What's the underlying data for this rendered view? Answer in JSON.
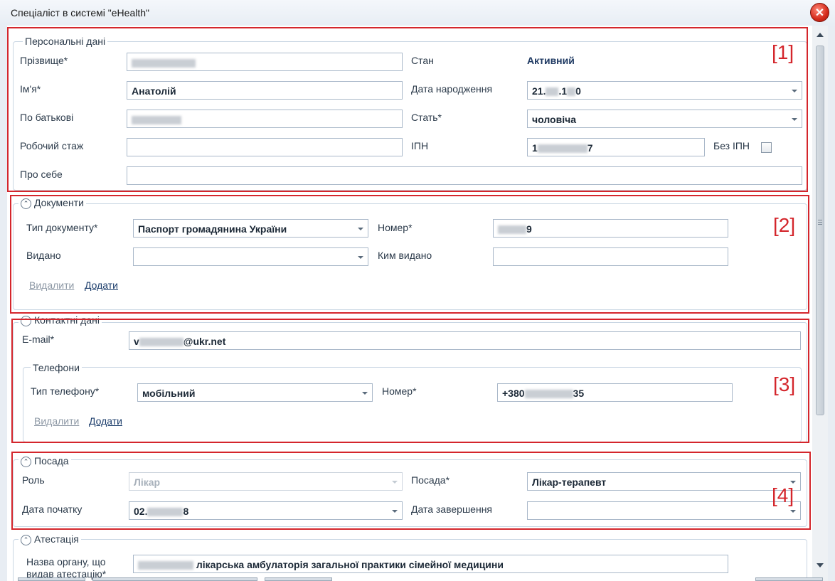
{
  "window": {
    "title": "Спеціаліст в системі \"eHealth\""
  },
  "personal": {
    "legend": "Персональні дані",
    "surname_label": "Прізвище*",
    "name_label": "Ім'я*",
    "name_value": "Анатолій",
    "patronymic_label": "По батькові",
    "experience_label": "Робочий стаж",
    "about_label": "Про себе",
    "status_label": "Стан",
    "status_value": "Активний",
    "birthdate_label": "Дата народження",
    "birthdate_parts": [
      "21.",
      ".1",
      "0"
    ],
    "sex_label": "Стать*",
    "sex_value": "чоловіча",
    "ipn_label": "ІПН",
    "ipn_parts": [
      "1",
      "7"
    ],
    "no_ipn_label": "Без ІПН",
    "tag": "[1]"
  },
  "documents": {
    "legend": "Документи",
    "doc_type_label": "Тип документу*",
    "doc_type_value": "Паспорт громадянина України",
    "number_label": "Номер*",
    "number_suffix": "9",
    "issued_label": "Видано",
    "issued_by_label": "Ким видано",
    "delete_link": "Видалити",
    "add_link": "Додати",
    "tag": "[2]"
  },
  "contacts": {
    "legend": "Контактні дані",
    "email_label": "E-mail*",
    "email_prefix": "v",
    "email_suffix": "@ukr.net",
    "phones_legend": "Телефони",
    "phone_type_label": "Тип телефону*",
    "phone_type_value": "мобільний",
    "phone_number_label": "Номер*",
    "phone_prefix": "+380",
    "phone_suffix": "35",
    "delete_link": "Видалити",
    "add_link": "Додати",
    "tag": "[3]"
  },
  "position": {
    "legend": "Посада",
    "role_label": "Роль",
    "role_value": "Лікар",
    "position_label": "Посада*",
    "position_value": "Лікар-терапевт",
    "start_label": "Дата початку",
    "start_prefix": "02.",
    "start_suffix": "8",
    "end_label": "Дата завершення",
    "tag": "[4]"
  },
  "attestation": {
    "legend": "Атестація",
    "org_label_line1": "Назва органу, що",
    "org_label_line2": "видав атестацію*",
    "org_value": "лікарська амбулаторія загальної практики сімейної медицини"
  },
  "colors": {
    "accent_red": "#d4262c",
    "status_blue": "#1f3a63"
  }
}
